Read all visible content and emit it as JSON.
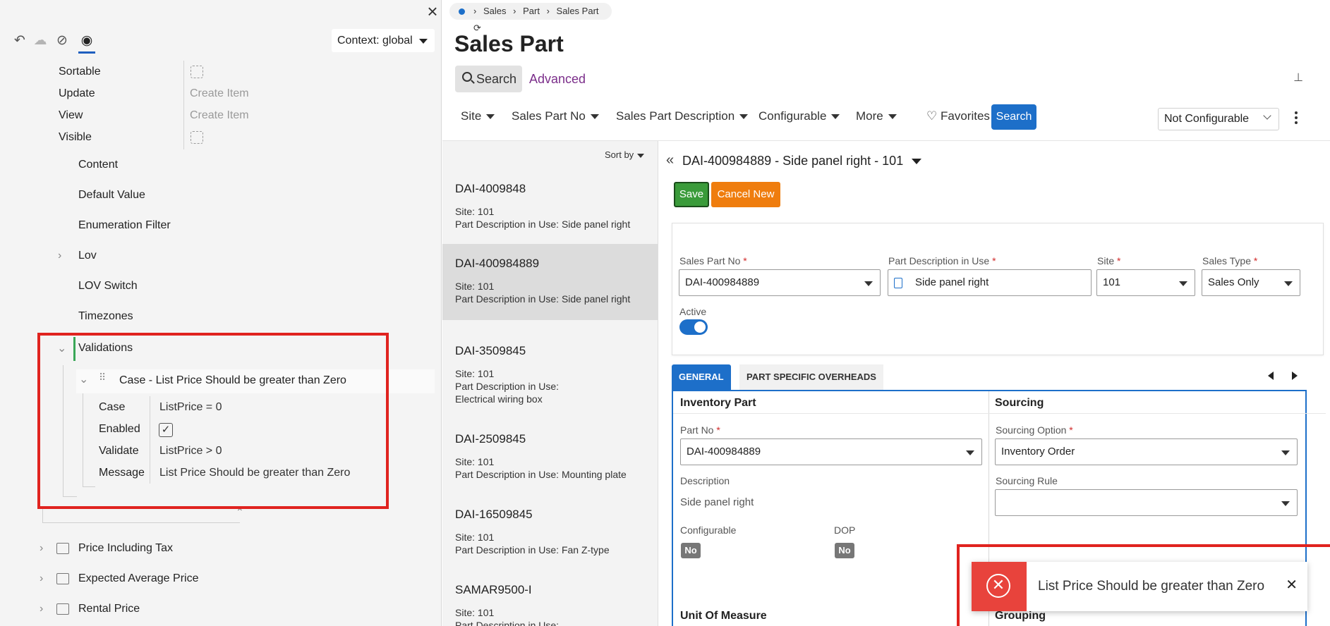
{
  "left_panel": {
    "context_label": "Context: global",
    "props": [
      {
        "label": "Sortable",
        "value": "",
        "checkbox": true
      },
      {
        "label": "Update",
        "value": "Create Item",
        "checkbox": false
      },
      {
        "label": "View",
        "value": "Create Item",
        "checkbox": false
      },
      {
        "label": "Visible",
        "value": "",
        "checkbox": true
      }
    ],
    "tree": [
      "Content",
      "Default Value",
      "Enumeration Filter",
      "Lov",
      "LOV Switch",
      "Timezones",
      "Validations"
    ],
    "validation_case": {
      "title": "Case - List Price Should be greater than Zero",
      "rows": [
        {
          "key": "Case",
          "value": "ListPrice = 0"
        },
        {
          "key": "Enabled",
          "value": "✓"
        },
        {
          "key": "Validate",
          "value": "ListPrice > 0"
        },
        {
          "key": "Message",
          "value": "List Price Should be greater than Zero"
        }
      ]
    },
    "bottom_items": [
      "Price Including Tax",
      "Expected Average Price",
      "Rental Price"
    ]
  },
  "app": {
    "breadcrumbs": [
      "Sales",
      "Part",
      "Sales Part"
    ],
    "page_title": "Sales Part",
    "search_tab": "Search",
    "advanced_tab": "Advanced",
    "filters": [
      "Site",
      "Sales Part No",
      "Sales Part Description",
      "Configurable",
      "More"
    ],
    "favorites": "Favorites",
    "search_button": "Search",
    "configurable_select": "Not Configurable",
    "sort_by": "Sort by",
    "list": [
      {
        "id": "DAI-4009848",
        "site": "Site:   101",
        "desc": "Part Description in Use:   Side panel right",
        "desc2": "",
        "selected": false
      },
      {
        "id": "DAI-400984889",
        "site": "Site:   101",
        "desc": "Part Description in Use:   Side panel right",
        "desc2": "",
        "selected": true
      },
      {
        "id": "DAI-3509845",
        "site": "Site:   101",
        "desc": "Part Description in Use:",
        "desc2": "Electrical wiring box",
        "selected": false
      },
      {
        "id": "DAI-2509845",
        "site": "Site:   101",
        "desc": "Part Description in Use:   Mounting plate",
        "desc2": "",
        "selected": false
      },
      {
        "id": "DAI-16509845",
        "site": "Site:   101",
        "desc": "Part Description in Use:   Fan Z-type",
        "desc2": "",
        "selected": false
      },
      {
        "id": "SAMAR9500-I",
        "site": "Site:   101",
        "desc": "Part Description in Use:",
        "desc2": "",
        "selected": false
      }
    ],
    "detail": {
      "title": "DAI-400984889 - Side panel right - 101",
      "save": "Save",
      "cancel": "Cancel New",
      "sales_part_no_label": "Sales Part No",
      "sales_part_no": "DAI-400984889",
      "part_desc_label": "Part Description in Use",
      "part_desc": "Side panel right",
      "site_label": "Site",
      "site": "101",
      "sales_type_label": "Sales Type",
      "sales_type": "Sales Only",
      "active_label": "Active",
      "required_mark": "*",
      "tabs": [
        "GENERAL",
        "PART SPECIFIC OVERHEADS"
      ],
      "inventory_part": "Inventory Part",
      "part_no_label": "Part No",
      "part_no": "DAI-400984889",
      "description_label": "Description",
      "description": "Side panel right",
      "configurable_label": "Configurable",
      "configurable": "No",
      "dop_label": "DOP",
      "dop": "No",
      "sourcing": "Sourcing",
      "sourcing_option_label": "Sourcing Option",
      "sourcing_option": "Inventory Order",
      "sourcing_rule_label": "Sourcing Rule",
      "unit_of_measure": "Unit Of Measure",
      "grouping": "Grouping"
    },
    "toast": {
      "message": "List Price Should be greater than Zero"
    }
  },
  "colors": {
    "accent": "#1d6fc9",
    "save": "#3a9b3a",
    "cancel": "#ef7d0e",
    "error": "#e8433c",
    "highlight_box": "#e0231f"
  }
}
